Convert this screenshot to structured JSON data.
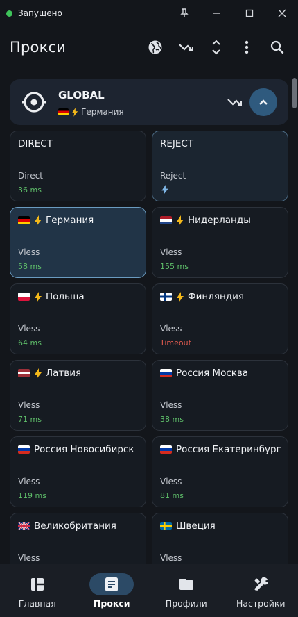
{
  "titlebar": {
    "status": "Запущено",
    "status_color": "#3ec45a",
    "controls": [
      "pin-icon",
      "minimize-icon",
      "maximize-icon",
      "close-icon"
    ]
  },
  "header": {
    "title": "Прокси",
    "actions": [
      "globe-icon",
      "speed-test-icon",
      "expand-collapse-icon",
      "more-vert-icon",
      "search-icon"
    ]
  },
  "group": {
    "name": "GLOBAL",
    "selected_label": "Германия",
    "selected_flag": "de",
    "icon": "global-target-icon",
    "speed_icon": "speed-test-icon",
    "collapse_icon": "chevron-up-icon"
  },
  "proxies": [
    {
      "name": "DIRECT",
      "flag": "",
      "bolt": false,
      "type": "Direct",
      "delay": "36 ms",
      "state": "normal",
      "status": "ok"
    },
    {
      "name": "REJECT",
      "flag": "",
      "bolt": false,
      "type": "Reject",
      "delay": "",
      "state": "hover",
      "status": "bolt"
    },
    {
      "name": "Германия",
      "flag": "de",
      "bolt": true,
      "type": "Vless",
      "delay": "58 ms",
      "state": "selected",
      "status": "ok"
    },
    {
      "name": "Нидерланды",
      "flag": "nl",
      "bolt": true,
      "type": "Vless",
      "delay": "155 ms",
      "state": "normal",
      "status": "ok"
    },
    {
      "name": "Польша",
      "flag": "pl",
      "bolt": true,
      "type": "Vless",
      "delay": "64 ms",
      "state": "normal",
      "status": "ok"
    },
    {
      "name": "Финляндия",
      "flag": "fi",
      "bolt": true,
      "type": "Vless",
      "delay": "Timeout",
      "state": "normal",
      "status": "timeout"
    },
    {
      "name": "Латвия",
      "flag": "lv",
      "bolt": true,
      "type": "Vless",
      "delay": "71 ms",
      "state": "normal",
      "status": "ok"
    },
    {
      "name": "Россия Москва",
      "flag": "ru",
      "bolt": false,
      "type": "Vless",
      "delay": "38 ms",
      "state": "normal",
      "status": "ok"
    },
    {
      "name": "Россия Новосибирск",
      "flag": "ru",
      "bolt": false,
      "type": "Vless",
      "delay": "119 ms",
      "state": "normal",
      "status": "ok"
    },
    {
      "name": "Россия Екатеринбург",
      "flag": "ru",
      "bolt": false,
      "type": "Vless",
      "delay": "81 ms",
      "state": "normal",
      "status": "ok"
    },
    {
      "name": "Великобритания",
      "flag": "gb",
      "bolt": false,
      "type": "Vless",
      "delay": "",
      "state": "normal",
      "status": "ok"
    },
    {
      "name": "Швеция",
      "flag": "se",
      "bolt": false,
      "type": "Vless",
      "delay": "",
      "state": "normal",
      "status": "ok"
    }
  ],
  "nav": [
    {
      "label": "Главная",
      "icon": "dashboard-icon",
      "active": false
    },
    {
      "label": "Прокси",
      "icon": "article-icon",
      "active": true
    },
    {
      "label": "Профили",
      "icon": "folder-icon",
      "active": false
    },
    {
      "label": "Настройки",
      "icon": "tools-icon",
      "active": false
    }
  ],
  "colors": {
    "background": "#13161b",
    "card": "#161b22",
    "selected_card": "#213447",
    "accent": "#2f5a7e",
    "delay_ok": "#5fbf6a",
    "delay_timeout": "#e05a4f"
  }
}
